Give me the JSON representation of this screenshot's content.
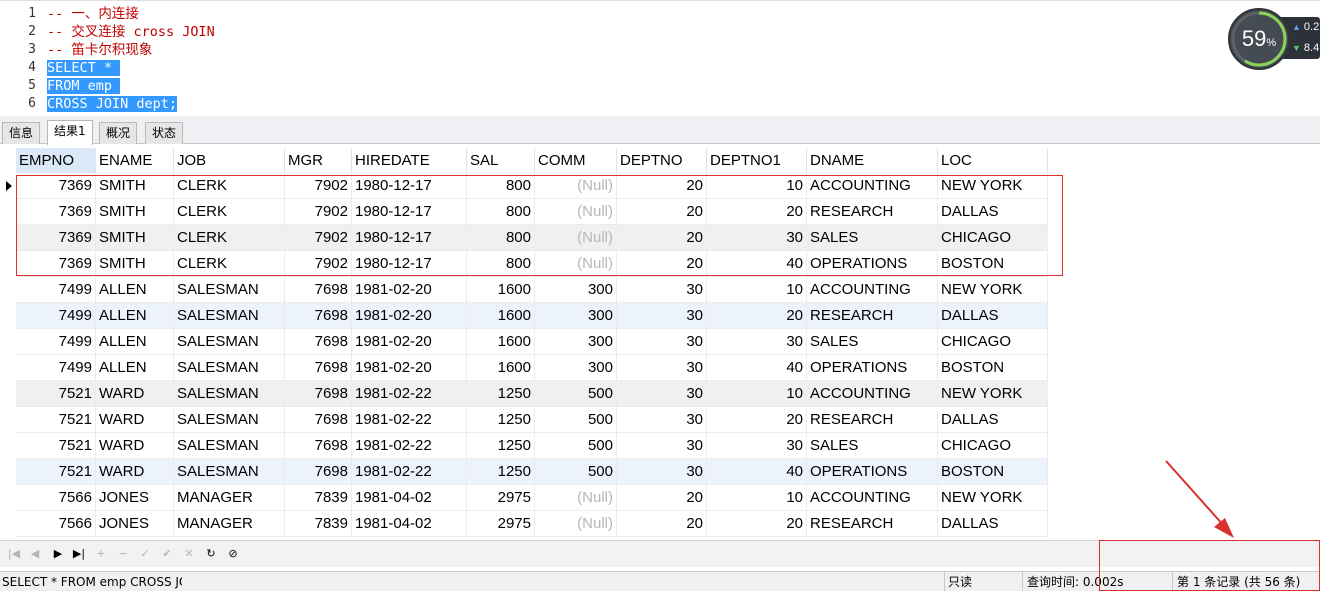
{
  "editor": {
    "line_numbers": [
      "1",
      "2",
      "3",
      "4",
      "5",
      "6"
    ],
    "lines": [
      {
        "text": "-- 一、内连接",
        "selected": false
      },
      {
        "text": "-- 交叉连接 cross JOIN",
        "selected": false
      },
      {
        "text": "-- 笛卡尔积现象",
        "selected": false
      },
      {
        "text": "SELECT * ",
        "selected": true
      },
      {
        "text": "FROM emp ",
        "selected": true
      },
      {
        "text": "CROSS JOIN dept;",
        "selected": true
      }
    ]
  },
  "monitor": {
    "cpu_percent_value": 59,
    "cpu_percent": "59",
    "percent_sign": "%",
    "upload": "0.2",
    "download": "8.4",
    "up_icon": "arrow-up-icon",
    "down_icon": "arrow-down-icon"
  },
  "tabs": [
    {
      "label": "信息",
      "active": false
    },
    {
      "label": "结果1",
      "active": true
    },
    {
      "label": "概况",
      "active": false
    },
    {
      "label": "状态",
      "active": false
    }
  ],
  "grid": {
    "columns": [
      "EMPNO",
      "ENAME",
      "JOB",
      "MGR",
      "HIREDATE",
      "SAL",
      "COMM",
      "DEPTNO",
      "DEPTNO1",
      "DNAME",
      "LOC"
    ],
    "rows": [
      [
        "7369",
        "SMITH",
        "CLERK",
        "7902",
        "1980-12-17",
        "800",
        "(Null)",
        "20",
        "10",
        "ACCOUNTING",
        "NEW YORK"
      ],
      [
        "7369",
        "SMITH",
        "CLERK",
        "7902",
        "1980-12-17",
        "800",
        "(Null)",
        "20",
        "20",
        "RESEARCH",
        "DALLAS"
      ],
      [
        "7369",
        "SMITH",
        "CLERK",
        "7902",
        "1980-12-17",
        "800",
        "(Null)",
        "20",
        "30",
        "SALES",
        "CHICAGO"
      ],
      [
        "7369",
        "SMITH",
        "CLERK",
        "7902",
        "1980-12-17",
        "800",
        "(Null)",
        "20",
        "40",
        "OPERATIONS",
        "BOSTON"
      ],
      [
        "7499",
        "ALLEN",
        "SALESMAN",
        "7698",
        "1981-02-20",
        "1600",
        "300",
        "30",
        "10",
        "ACCOUNTING",
        "NEW YORK"
      ],
      [
        "7499",
        "ALLEN",
        "SALESMAN",
        "7698",
        "1981-02-20",
        "1600",
        "300",
        "30",
        "20",
        "RESEARCH",
        "DALLAS"
      ],
      [
        "7499",
        "ALLEN",
        "SALESMAN",
        "7698",
        "1981-02-20",
        "1600",
        "300",
        "30",
        "30",
        "SALES",
        "CHICAGO"
      ],
      [
        "7499",
        "ALLEN",
        "SALESMAN",
        "7698",
        "1981-02-20",
        "1600",
        "300",
        "30",
        "40",
        "OPERATIONS",
        "BOSTON"
      ],
      [
        "7521",
        "WARD",
        "SALESMAN",
        "7698",
        "1981-02-22",
        "1250",
        "500",
        "30",
        "10",
        "ACCOUNTING",
        "NEW YORK"
      ],
      [
        "7521",
        "WARD",
        "SALESMAN",
        "7698",
        "1981-02-22",
        "1250",
        "500",
        "30",
        "20",
        "RESEARCH",
        "DALLAS"
      ],
      [
        "7521",
        "WARD",
        "SALESMAN",
        "7698",
        "1981-02-22",
        "1250",
        "500",
        "30",
        "30",
        "SALES",
        "CHICAGO"
      ],
      [
        "7521",
        "WARD",
        "SALESMAN",
        "7698",
        "1981-02-22",
        "1250",
        "500",
        "30",
        "40",
        "OPERATIONS",
        "BOSTON"
      ],
      [
        "7566",
        "JONES",
        "MANAGER",
        "7839",
        "1981-04-02",
        "2975",
        "(Null)",
        "20",
        "10",
        "ACCOUNTING",
        "NEW YORK"
      ],
      [
        "7566",
        "JONES",
        "MANAGER",
        "7839",
        "1981-04-02",
        "2975",
        "(Null)",
        "20",
        "20",
        "RESEARCH",
        "DALLAS"
      ]
    ]
  },
  "toolbar": {
    "buttons": [
      {
        "icon": "first-record-icon",
        "glyph": "|◀",
        "enabled": false
      },
      {
        "icon": "previous-record-icon",
        "glyph": "◀",
        "enabled": false
      },
      {
        "icon": "next-record-icon",
        "glyph": "▶",
        "enabled": true
      },
      {
        "icon": "last-record-icon",
        "glyph": "▶|",
        "enabled": true
      },
      {
        "icon": "add-record-icon",
        "glyph": "+",
        "enabled": false
      },
      {
        "icon": "delete-record-icon",
        "glyph": "−",
        "enabled": false
      },
      {
        "icon": "edit-record-icon",
        "glyph": "✓",
        "enabled": false
      },
      {
        "icon": "apply-changes-icon",
        "glyph": "✔",
        "enabled": false
      },
      {
        "icon": "discard-changes-icon",
        "glyph": "✕",
        "enabled": false
      },
      {
        "icon": "refresh-icon",
        "glyph": "↻",
        "enabled": true
      },
      {
        "icon": "stop-icon",
        "glyph": "⊘",
        "enabled": true
      }
    ]
  },
  "statusbar": {
    "query": "SELECT *  FROM emp CROSS JOIN dept;",
    "mode": "只读",
    "query_time": "查询时间: 0.002s",
    "record_info": "第 1 条记录 (共 56 条)"
  },
  "colors": {
    "annotation": "#d9322e",
    "comment": "#c00000",
    "selection": "#3399ff"
  }
}
